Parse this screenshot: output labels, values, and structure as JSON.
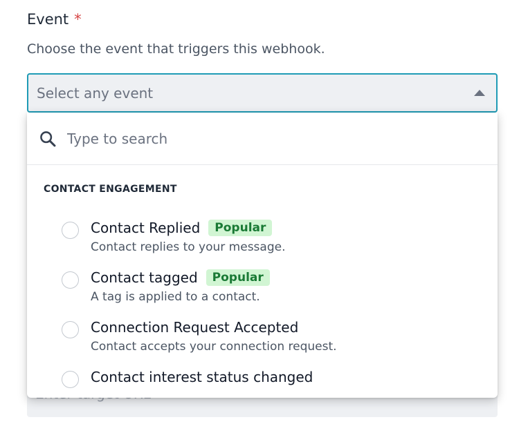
{
  "field": {
    "label": "Event",
    "required_mark": "*",
    "help": "Choose the event that triggers this webhook.",
    "select_placeholder": "Select any event"
  },
  "under_field": {
    "placeholder": "Enter target URL"
  },
  "dropdown": {
    "search_placeholder": "Type to search",
    "group_title": "CONTACT ENGAGEMENT",
    "options": [
      {
        "title": "Contact Replied",
        "badge": "Popular",
        "desc": "Contact replies to your message."
      },
      {
        "title": "Contact tagged",
        "badge": "Popular",
        "desc": "A tag is applied to a contact."
      },
      {
        "title": "Connection Request Accepted",
        "badge": "",
        "desc": "Contact accepts your connection request."
      },
      {
        "title": "Contact interest status changed",
        "badge": "",
        "desc": ""
      }
    ]
  },
  "colors": {
    "accent_border": "#1e9bb5",
    "required": "#d64545",
    "badge_bg": "#d1f5d3",
    "badge_text": "#1a7a35"
  },
  "icons": {
    "search": "search-icon",
    "caret": "caret-up-icon",
    "radio": "radio-unchecked-icon"
  }
}
